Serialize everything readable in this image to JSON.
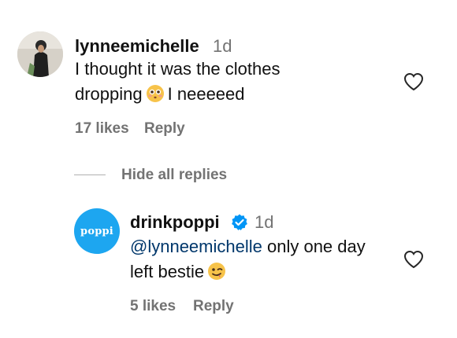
{
  "comment": {
    "username": "lynneemichelle",
    "time": "1d",
    "text_line1": "I thought it was the clothes",
    "text_line2_before": "dropping",
    "text_line2_after": "I neeeeed",
    "likes": "17 likes",
    "reply": "Reply",
    "emoji_icon": "flushed-face-icon"
  },
  "replies_toggle": "Hide all replies",
  "reply_comment": {
    "username": "drinkpoppi",
    "verified_icon": "verified-badge-icon",
    "time": "1d",
    "mention": "@lynneemichelle",
    "text_after_mention": "only one day",
    "text_line2": "left bestie",
    "likes": "5 likes",
    "reply": "Reply",
    "emoji_icon": "winking-face-icon",
    "avatar_logo": "poppi"
  },
  "colors": {
    "secondary_text": "#737373",
    "mention": "#00376b",
    "verified": "#0095f6",
    "brand_avatar": "#1da6f0"
  }
}
